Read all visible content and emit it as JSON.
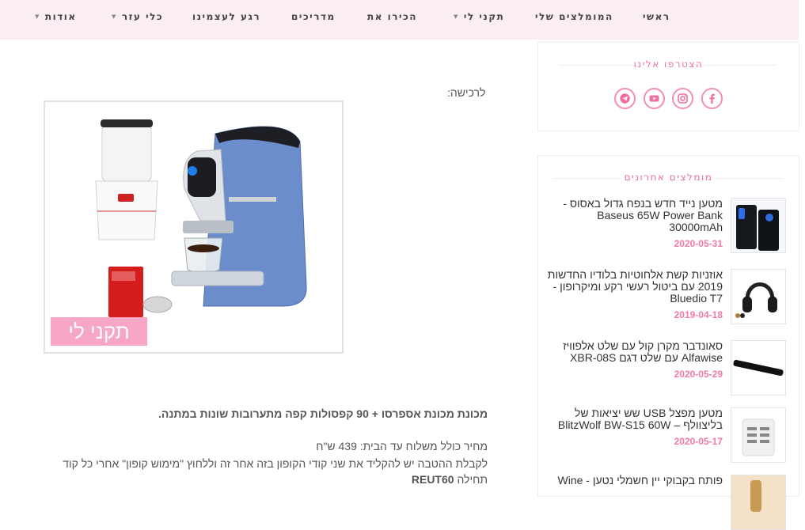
{
  "nav": {
    "items": [
      {
        "label": "ראשי"
      },
      {
        "label": "המומלצים שלי"
      },
      {
        "label": "תקני לי"
      },
      {
        "label": "הכירו את"
      },
      {
        "label": "מדריכים"
      },
      {
        "label": "רגע לעצמינו"
      },
      {
        "label": "כלי עזר"
      },
      {
        "label": "אודות"
      }
    ],
    "caret": "▼"
  },
  "join_widget": {
    "title": "הצטרפו אלינו",
    "icons": [
      "facebook-icon",
      "instagram-icon",
      "youtube-icon",
      "telegram-icon"
    ]
  },
  "recent_widget": {
    "title": "מומלצים אחרונים",
    "posts": [
      {
        "title": "מטען נייד חדש בנפח גדול באסוס - Baseus 65W Power Bank 30000mAh",
        "date": "2020-05-31"
      },
      {
        "title": "אוזניות קשת אלחוטיות בלודיו החדשות 2019 עם ביטול רעשי רקע ומיקרופון - Bluedio T7",
        "date": "2019-04-18"
      },
      {
        "title": "סאונדבר מקרן קול עם שלט אלפוויז Alfawise עם שלט דגם XBR-08S",
        "date": "2020-05-29"
      },
      {
        "title": "מטען מפצל USB שש יציאות של בליצוולף – BlitzWolf BW-S15 60W",
        "date": "2020-05-17"
      },
      {
        "title": "פותח בקבוקי יין חשמלי נטען - Wine"
      }
    ]
  },
  "article": {
    "purchase_label": "לרכישה:",
    "product_badge": "תקני לי",
    "headline": "מכונת מכונת אספרסו + 90 קפסולות קפה מתערובות שונות במתנה.",
    "price_line": "מחיר כולל משלוח עד הבית: 439 ש\"ח",
    "coupon_line": "לקבלת ההטבה יש להקליד את שני קודי הקופון בזה אחר זה וללחוץ \"מימוש קופון\" אחרי כל קוד",
    "start_prefix": "תחילה",
    "code": "REUT60"
  }
}
